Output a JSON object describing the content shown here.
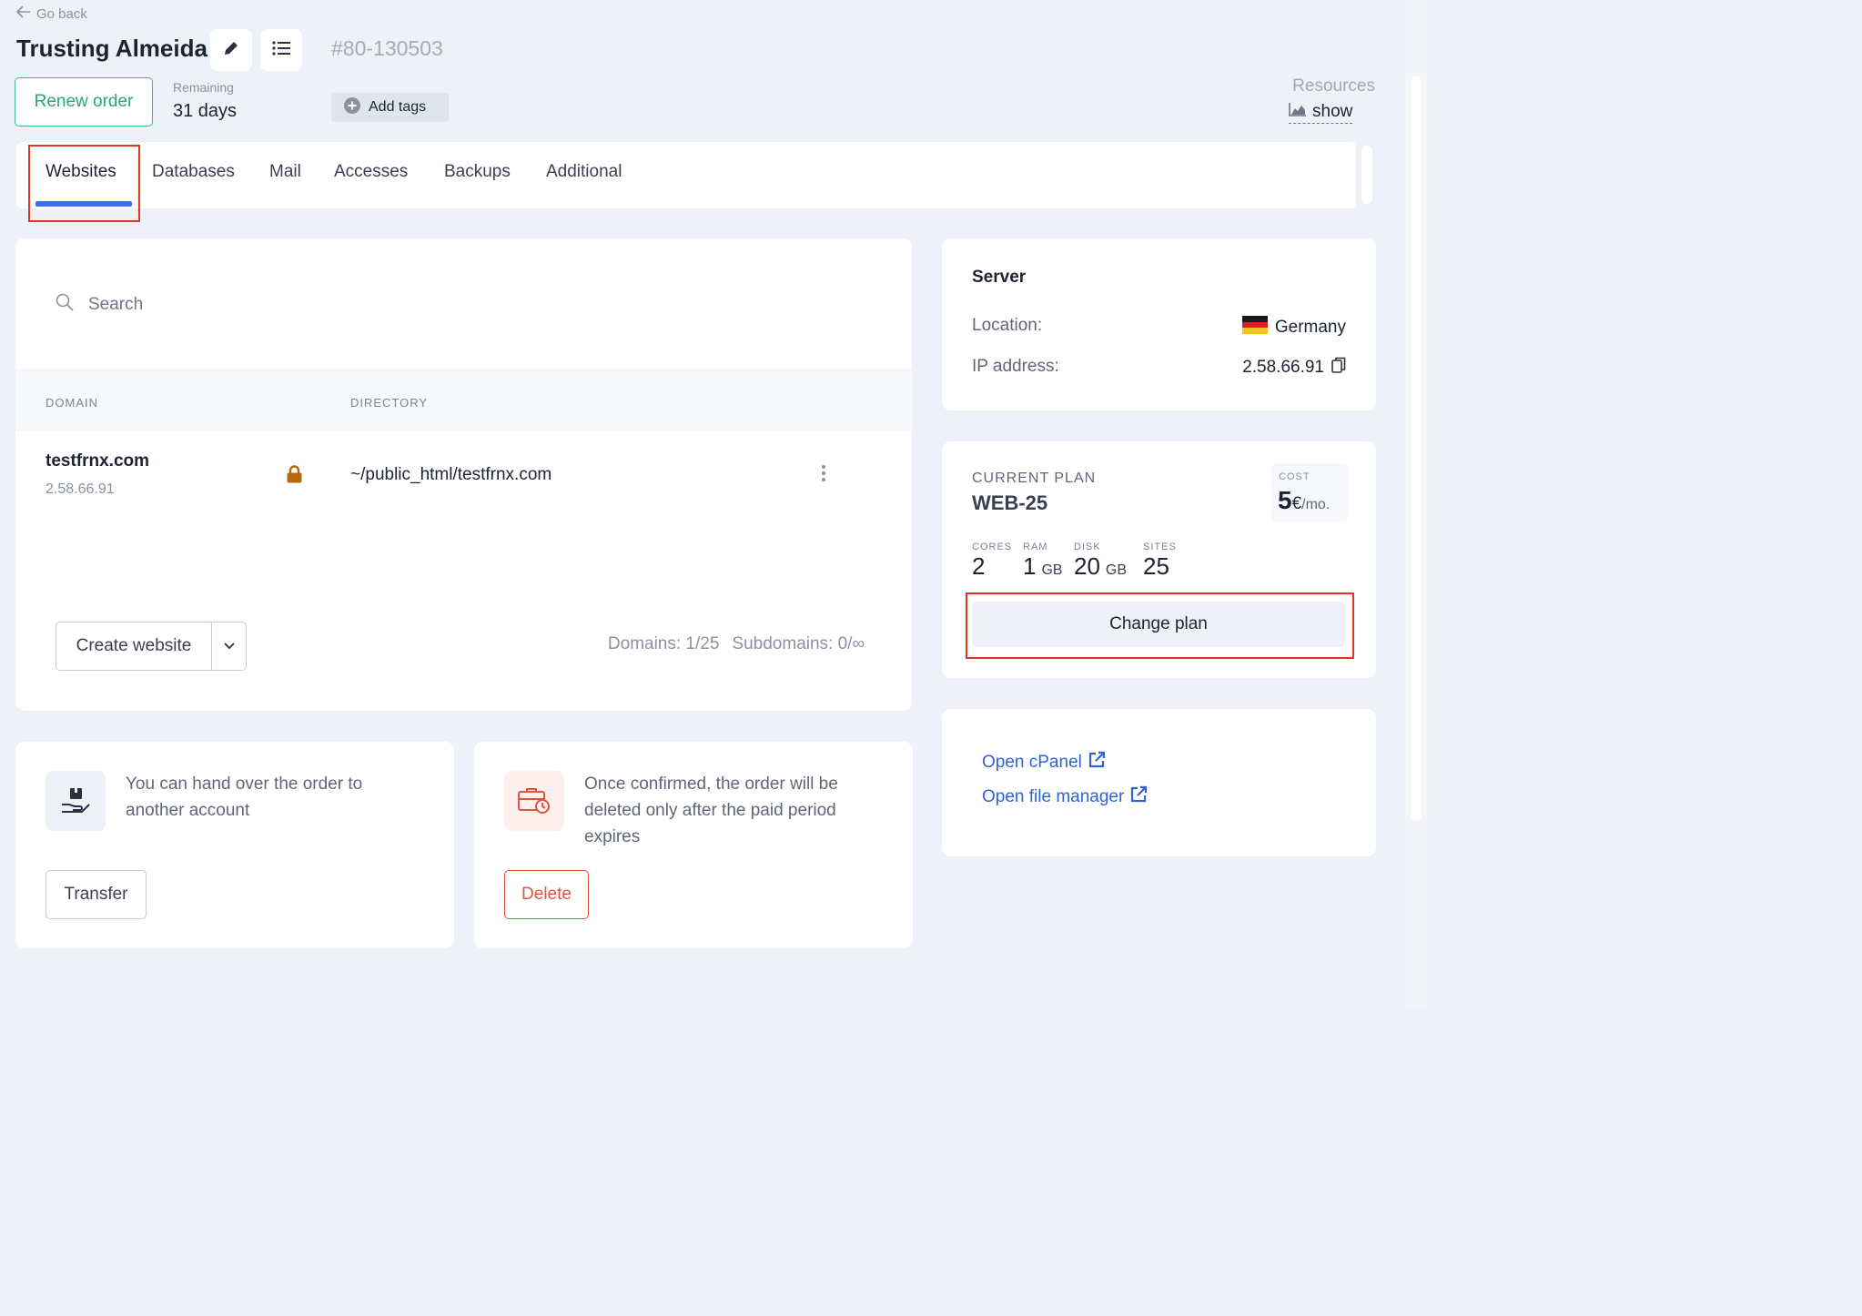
{
  "header": {
    "back_label": "Go back",
    "title": "Trusting Almeida",
    "order_id": "80-130503",
    "renew_label": "Renew order",
    "remaining_label": "Remaining",
    "remaining_value": "31 days",
    "add_tags_label": "Add tags",
    "resources_label": "Resources",
    "resources_link": "show"
  },
  "tabs": [
    {
      "label": "Websites",
      "active": true
    },
    {
      "label": "Databases"
    },
    {
      "label": "Mail"
    },
    {
      "label": "Accesses"
    },
    {
      "label": "Backups"
    },
    {
      "label": "Additional"
    }
  ],
  "websites": {
    "search_placeholder": "Search",
    "columns": [
      "DOMAIN",
      "DIRECTORY"
    ],
    "rows": [
      {
        "domain": "testfrnx.com",
        "ip": "2.58.66.91",
        "directory": "~/public_html/testfrnx.com"
      }
    ],
    "create_label": "Create website",
    "domains_count": "Domains: 1/25",
    "subdomains_count": "Subdomains: 0/∞"
  },
  "transfer_card": {
    "text": "You can hand over the order to another account",
    "button": "Transfer"
  },
  "delete_card": {
    "text": "Once confirmed, the order will be deleted only after the paid period expires",
    "button": "Delete"
  },
  "server": {
    "title": "Server",
    "location_label": "Location:",
    "location_value": "Germany",
    "ip_label": "IP address:",
    "ip_value": "2.58.66.91"
  },
  "plan": {
    "label": "CURRENT PLAN",
    "name": "WEB-25",
    "cost_label": "COST",
    "cost_value": "5",
    "cost_currency": "€",
    "cost_period": "/mo.",
    "specs": [
      {
        "label": "CORES",
        "value": "2",
        "unit": ""
      },
      {
        "label": "RAM",
        "value": "1",
        "unit": "GB"
      },
      {
        "label": "DISK",
        "value": "20",
        "unit": "GB"
      },
      {
        "label": "SITES",
        "value": "25",
        "unit": ""
      }
    ],
    "change_label": "Change plan"
  },
  "links": {
    "cpanel": "Open cPanel",
    "file_manager": "Open file manager"
  },
  "colors": {
    "accent": "#3a6bf0",
    "highlight": "#e0361e",
    "renew": "#2aa574",
    "delete": "#e0553e",
    "link": "#2f63d8"
  },
  "icons": [
    "arrow-left-icon",
    "pencil-icon",
    "list-icon",
    "plus-circle-icon",
    "chart-icon",
    "search-icon",
    "lock-icon",
    "kebab-icon",
    "chevron-down-icon",
    "hand-box-icon",
    "briefcase-clock-icon",
    "flag-germany-icon",
    "copy-icon",
    "external-link-icon"
  ]
}
